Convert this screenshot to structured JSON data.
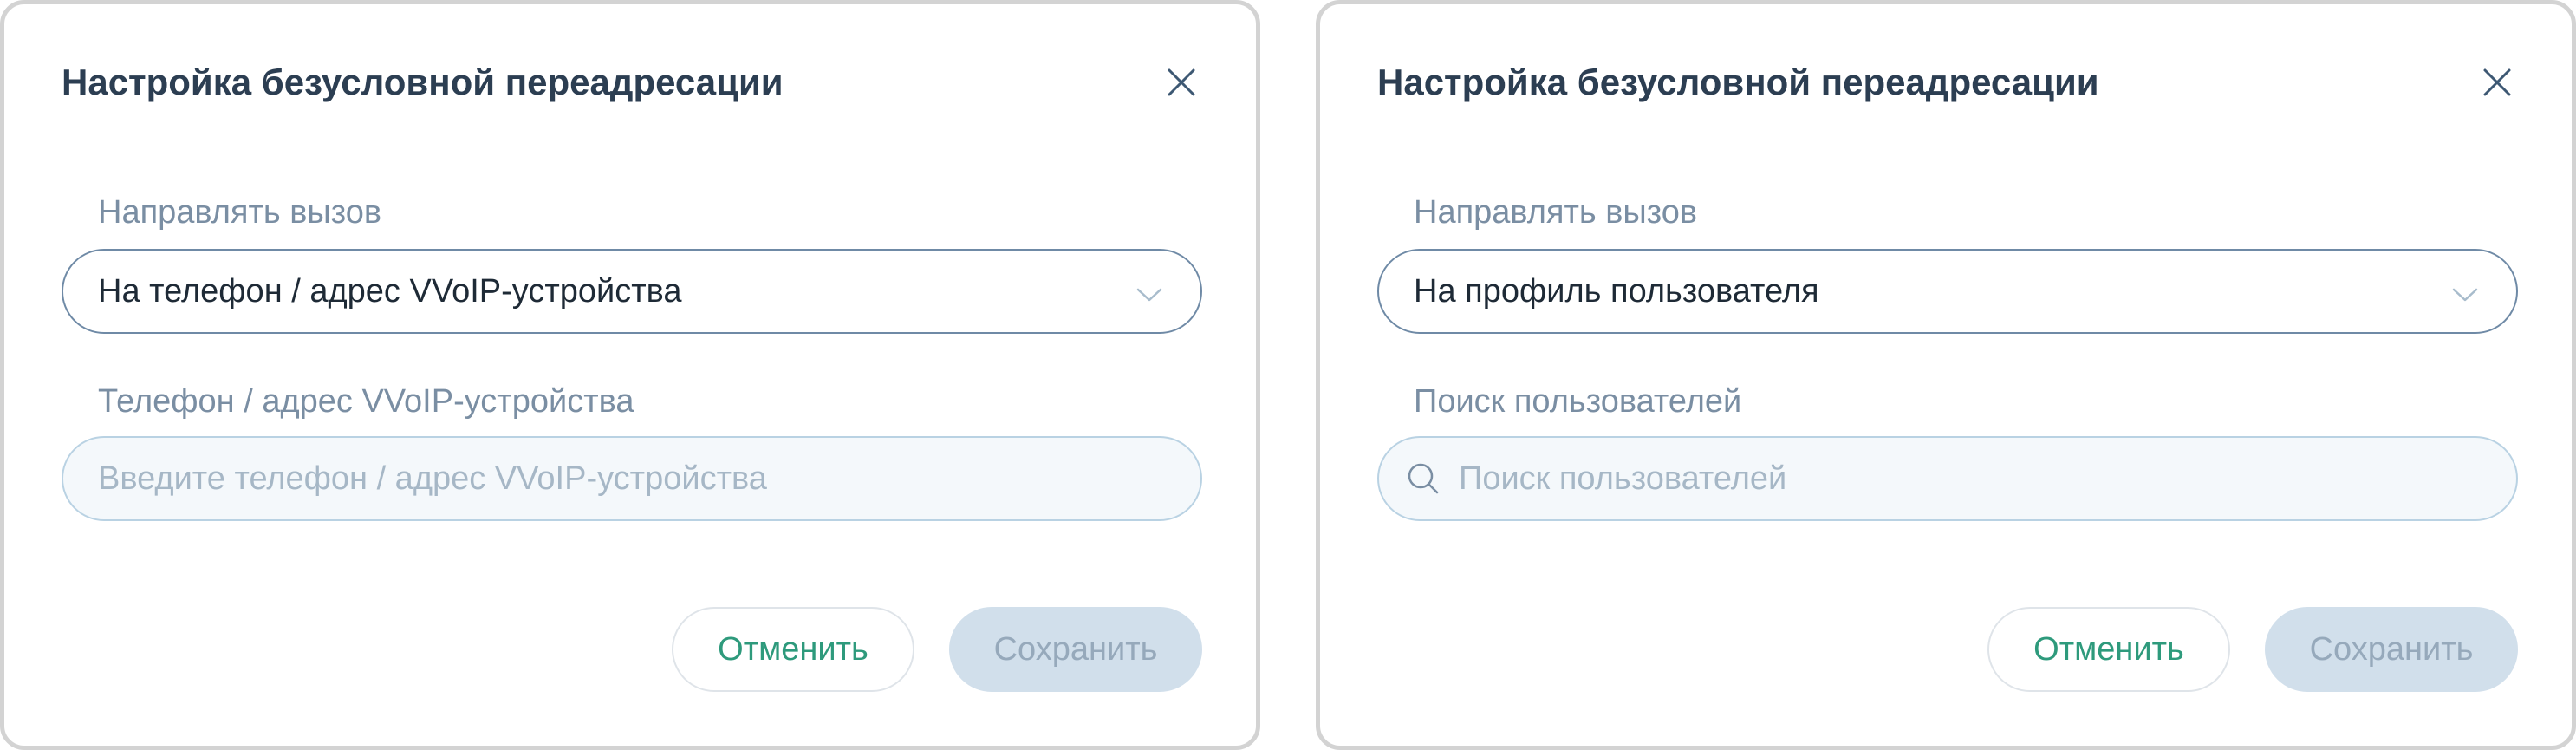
{
  "dialogs": [
    {
      "title": "Настройка безусловной переадресации",
      "route_label": "Направлять вызов",
      "route_value": "На телефон / адрес VVoIP-устройства",
      "second_field_label": "Телефон / адрес VVoIP-устройства",
      "second_field_placeholder": "Введите телефон / адрес VVoIP-устройства",
      "cancel_label": "Отменить",
      "save_label": "Сохранить"
    },
    {
      "title": "Настройка безусловной переадресации",
      "route_label": "Направлять вызов",
      "route_value": "На профиль пользователя",
      "second_field_label": "Поиск пользователей",
      "second_field_placeholder": "Поиск пользователей",
      "cancel_label": "Отменить",
      "save_label": "Сохранить"
    }
  ],
  "icons": {
    "close": "close-icon",
    "dropdown": "chevron-down-icon",
    "search": "search-icon"
  },
  "colors": {
    "title": "#2c3e52",
    "label": "#7a8ea3",
    "accent_green": "#2e9a7c",
    "save_disabled_bg": "#d1dfeb",
    "save_disabled_text": "#96a9bb",
    "input_bg": "#f4f8fb",
    "select_border": "#6f8aa6"
  }
}
